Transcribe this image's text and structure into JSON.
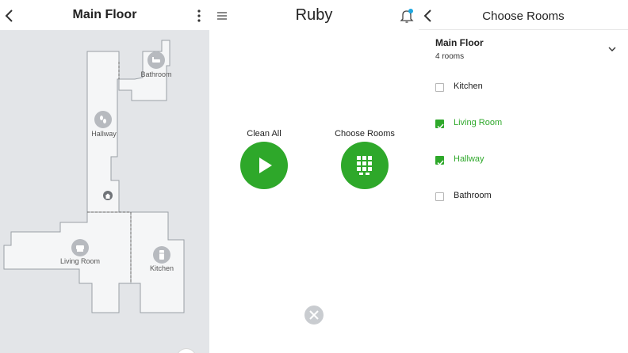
{
  "colors": {
    "accent_green": "#2ea82a",
    "map_background": "#e3e5e8",
    "room_fill": "#f5f6f7",
    "notification_dot": "#1ea7e0"
  },
  "map_panel": {
    "title": "Main Floor",
    "back_icon": "chevron-left-icon",
    "menu_icon": "kebab-icon",
    "rooms": [
      {
        "name": "Bathroom",
        "icon": "bathtub-icon"
      },
      {
        "name": "Hallway",
        "icon": "footsteps-icon"
      },
      {
        "name": "Living Room",
        "icon": "armchair-icon"
      },
      {
        "name": "Kitchen",
        "icon": "fridge-icon"
      }
    ],
    "home_icon": "home-base-icon"
  },
  "main_panel": {
    "menu_icon": "hamburger-icon",
    "robot_name": "Ruby",
    "bell_icon": "bell-icon",
    "clean_all": {
      "label": "Clean All",
      "icon": "play-icon"
    },
    "choose_rooms": {
      "label": "Choose Rooms",
      "icon": "grid-icon"
    },
    "close_icon": "close-icon"
  },
  "rooms_panel": {
    "title": "Choose Rooms",
    "back_icon": "chevron-left-icon",
    "floor": {
      "name": "Main Floor",
      "room_count": "4 rooms",
      "icon": "chevron-down-icon"
    },
    "rooms": [
      {
        "name": "Kitchen",
        "checked": false
      },
      {
        "name": "Living Room",
        "checked": true
      },
      {
        "name": "Hallway",
        "checked": true
      },
      {
        "name": "Bathroom",
        "checked": false
      }
    ]
  }
}
